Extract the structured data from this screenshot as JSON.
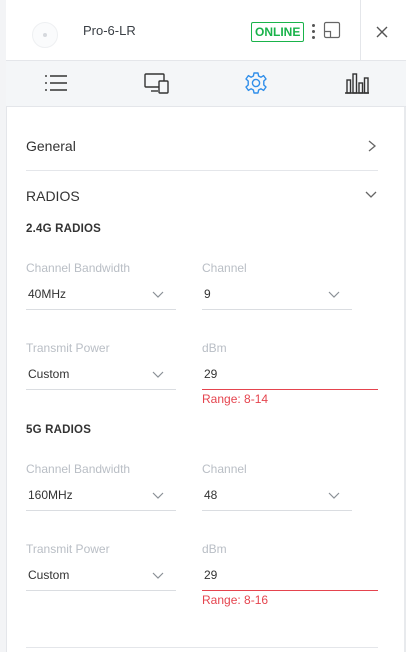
{
  "header": {
    "device_name": "Pro-6-LR",
    "status": "ONLINE",
    "status_color": "#19b34a"
  },
  "tabs": [
    {
      "icon": "list-icon",
      "active": false
    },
    {
      "icon": "devices-icon",
      "active": false
    },
    {
      "icon": "gear-icon",
      "active": true
    },
    {
      "icon": "bar-chart-icon",
      "active": false
    }
  ],
  "sections": {
    "general": "General",
    "radios": "RADIOS"
  },
  "radio_24": {
    "title": "2.4G RADIOS",
    "bandwidth_label": "Channel Bandwidth",
    "bandwidth_value": "40MHz",
    "channel_label": "Channel",
    "channel_value": "9",
    "power_label": "Transmit Power",
    "power_value": "Custom",
    "dbm_label": "dBm",
    "dbm_value": "29",
    "dbm_error": "Range: 8-14"
  },
  "radio_5": {
    "title": "5G RADIOS",
    "bandwidth_label": "Channel Bandwidth",
    "bandwidth_value": "160MHz",
    "channel_label": "Channel",
    "channel_value": "48",
    "power_label": "Transmit Power",
    "power_value": "Custom",
    "dbm_label": "dBm",
    "dbm_value": "29",
    "dbm_error": "Range: 8-16"
  },
  "colors": {
    "accent": "#2f8eea",
    "error": "#e5444e",
    "label": "#b9bec5"
  }
}
